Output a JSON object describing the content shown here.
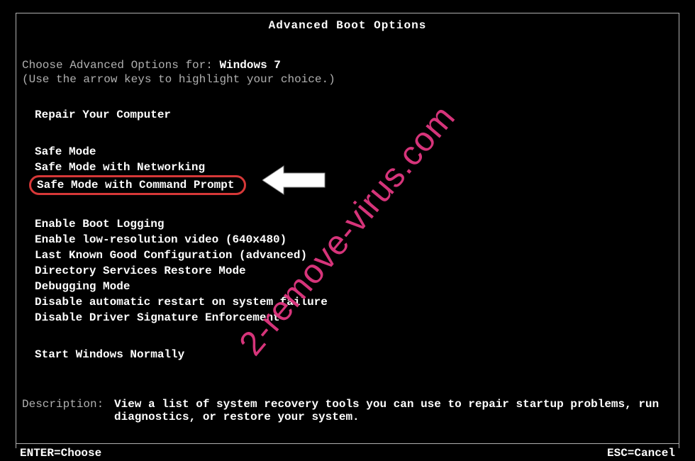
{
  "title": "Advanced Boot Options",
  "choose_prefix": "Choose Advanced Options for: ",
  "os_name": "Windows 7",
  "instruction": "(Use the arrow keys to highlight your choice.)",
  "group1": [
    "Repair Your Computer"
  ],
  "group2": [
    "Safe Mode",
    "Safe Mode with Networking",
    "Safe Mode with Command Prompt"
  ],
  "group3": [
    "Enable Boot Logging",
    "Enable low-resolution video (640x480)",
    "Last Known Good Configuration (advanced)",
    "Directory Services Restore Mode",
    "Debugging Mode",
    "Disable automatic restart on system failure",
    "Disable Driver Signature Enforcement"
  ],
  "group4": [
    "Start Windows Normally"
  ],
  "description_label": "Description:",
  "description_text": "View a list of system recovery tools you can use to repair startup problems, run diagnostics, or restore your system.",
  "footer_left": "ENTER=Choose",
  "footer_right": "ESC=Cancel",
  "watermark": "2-remove-virus.com",
  "highlight_color": "#d63838",
  "watermark_color": "#d6347a"
}
